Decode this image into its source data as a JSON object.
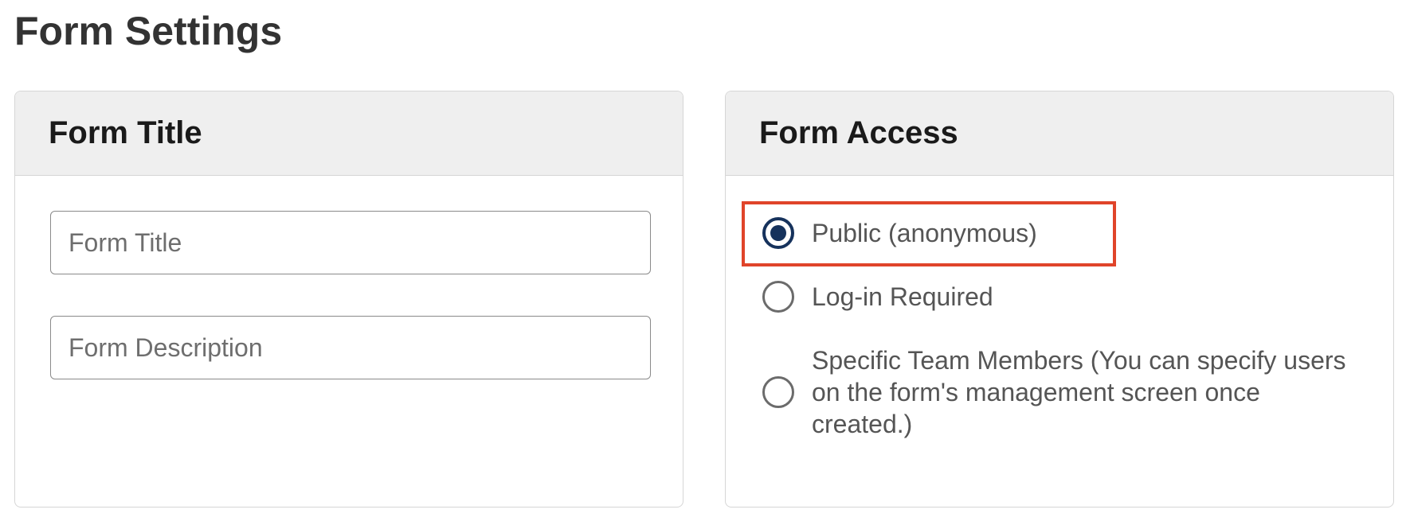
{
  "page": {
    "title": "Form Settings"
  },
  "form_title_panel": {
    "header": "Form Title",
    "title_input": {
      "placeholder": "Form Title",
      "value": ""
    },
    "description_input": {
      "placeholder": "Form Description",
      "value": ""
    }
  },
  "form_access_panel": {
    "header": "Form Access",
    "selected_option": "public",
    "options": [
      {
        "id": "public",
        "label": "Public (anonymous)",
        "checked": true
      },
      {
        "id": "login",
        "label": "Log-in Required",
        "checked": false
      },
      {
        "id": "team",
        "label": "Specific Team Members (You can specify users on the form's management screen once created.)",
        "checked": false
      }
    ]
  },
  "colors": {
    "highlight": "#e0442a",
    "radio_selected": "#16325c",
    "header_background": "#efefef"
  }
}
